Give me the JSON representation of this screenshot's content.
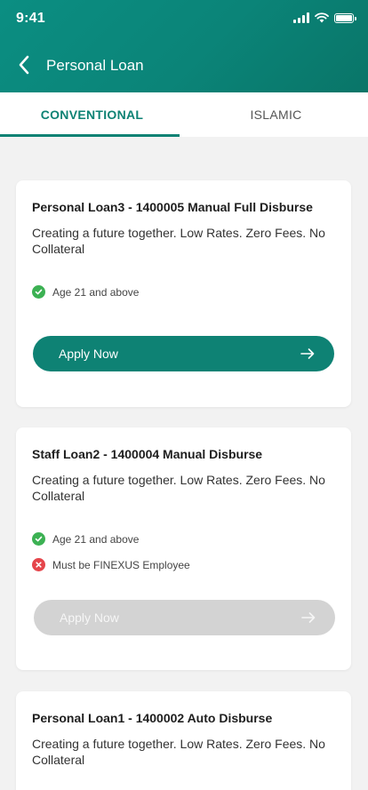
{
  "status_bar": {
    "time": "9:41"
  },
  "header": {
    "title": "Personal Loan"
  },
  "tabs": [
    {
      "label": "CONVENTIONAL",
      "active": true
    },
    {
      "label": "ISLAMIC",
      "active": false
    }
  ],
  "loans": [
    {
      "title": "Personal Loan3 - 1400005 Manual Full Disburse",
      "description": "Creating a future together. Low Rates. Zero Fees. No Collateral",
      "requirements": [
        {
          "text": "Age 21 and above",
          "met": true
        }
      ],
      "apply_label": "Apply Now",
      "apply_enabled": true
    },
    {
      "title": "Staff Loan2 - 1400004 Manual Disburse",
      "description": "Creating a future together. Low Rates. Zero Fees. No Collateral",
      "requirements": [
        {
          "text": "Age 21 and above",
          "met": true
        },
        {
          "text": "Must be FINEXUS Employee",
          "met": false
        }
      ],
      "apply_label": "Apply Now",
      "apply_enabled": false
    },
    {
      "title": "Personal Loan1 - 1400002 Auto Disburse",
      "description": "Creating a future together. Low Rates. Zero Fees. No Collateral"
    }
  ],
  "colors": {
    "primary": "#0e8274",
    "success": "#3cb153",
    "error": "#e5454b",
    "disabled": "#d3d3d3"
  },
  "icons": {
    "back": "chevron-left-icon",
    "apply": "arrow-right-icon",
    "met": "check-circle-icon",
    "unmet": "x-circle-icon"
  }
}
